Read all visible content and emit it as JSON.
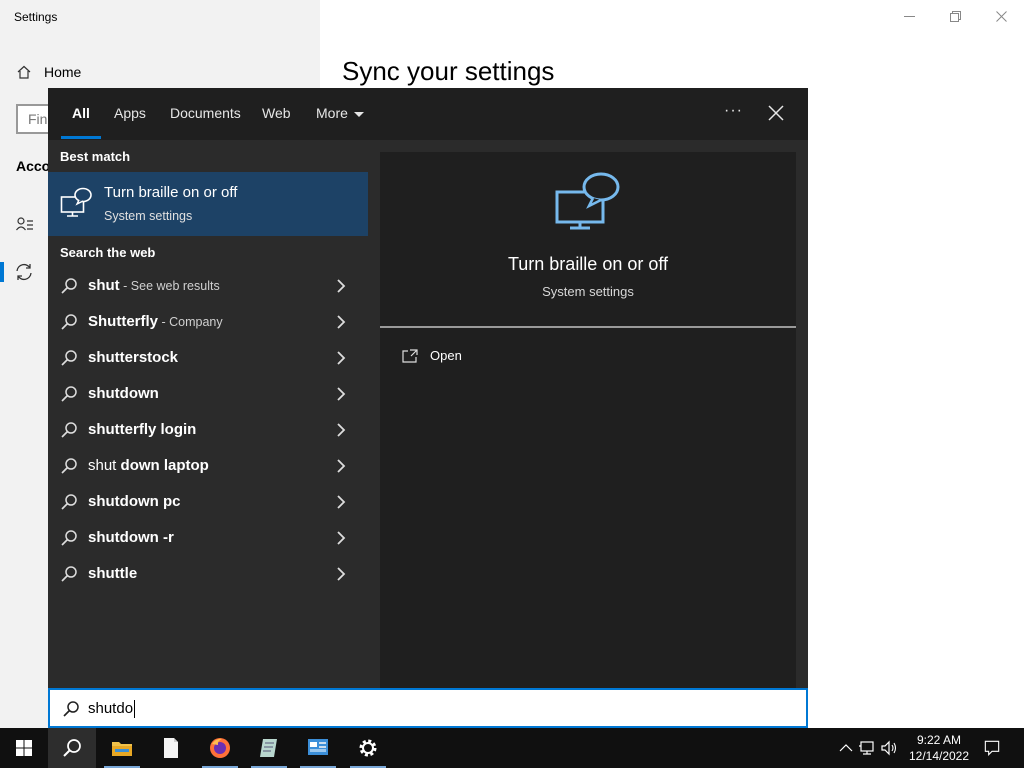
{
  "settings": {
    "window_title": "Settings",
    "home_label": "Home",
    "find_placeholder": "Fin",
    "section_label": "Acco",
    "page_heading": "Sync your settings"
  },
  "search_flyout": {
    "tabs": [
      "All",
      "Apps",
      "Documents",
      "Web",
      "More"
    ],
    "active_tab": "All",
    "best_match_header": "Best match",
    "best_match": {
      "title": "Turn braille on or off",
      "subtitle": "System settings",
      "icon": "braille-settings-icon"
    },
    "search_web_header": "Search the web",
    "web_results": [
      {
        "bold": "shut",
        "normal": "",
        "sub": " - See web results"
      },
      {
        "bold": "Shutterfly",
        "normal": "",
        "sub": " - Company"
      },
      {
        "bold": "shutterstock",
        "normal": "",
        "sub": ""
      },
      {
        "bold": "shutdown",
        "normal": "",
        "sub": ""
      },
      {
        "bold": "shutterfly login",
        "normal": "",
        "sub": ""
      },
      {
        "bold": "down laptop",
        "prefix": "shut ",
        "sub": ""
      },
      {
        "bold": "shutdown pc",
        "normal": "",
        "sub": ""
      },
      {
        "bold": "shutdown -r",
        "normal": "",
        "sub": ""
      },
      {
        "bold": "shuttle",
        "normal": "",
        "sub": ""
      }
    ],
    "preview": {
      "title": "Turn braille on or off",
      "subtitle": "System settings",
      "actions": [
        {
          "label": "Open",
          "icon": "open-icon"
        }
      ]
    },
    "search_query": "shutdo"
  },
  "taskbar": {
    "pinned": [
      "start-icon",
      "search-icon",
      "file-explorer-icon",
      "notepad-icon",
      "firefox-icon",
      "app-icon",
      "control-panel-icon",
      "settings-icon"
    ],
    "clock_time": "9:22 AM",
    "clock_date": "12/14/2022"
  },
  "colors": {
    "accent": "#0078d4",
    "flyout_bg": "#2b2b2b",
    "best_match_bg": "#1d4266",
    "taskbar_bg": "#101010"
  }
}
